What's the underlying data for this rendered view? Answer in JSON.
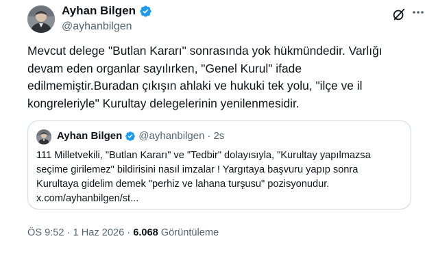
{
  "author": {
    "name": "Ayhan Bilgen",
    "handle": "@ayhanbilgen"
  },
  "icons": {
    "verified": "verified-badge-icon",
    "grok": "grok-icon",
    "more": "more-options-icon"
  },
  "colors": {
    "verified_blue": "#1d9bf0",
    "secondary_text": "#536471",
    "primary_text": "#0f1419",
    "border": "#cfd9de"
  },
  "tweet": {
    "lines": [
      "Mevcut delege \"Butlan Kararı\" sonrasında yok hükmündedir. Varlığı",
      "devam eden organlar sayılırken, \"Genel Kurul\" ifade",
      "edilmemiştir.Buradan çıkışın ahlaki ve hukuki tek yolu, \"ilçe ve il",
      "kongreleriyle\" Kurultay delegelerinin yenilenmesidir."
    ]
  },
  "quote": {
    "name": "Ayhan Bilgen",
    "handle": "@ayhanbilgen",
    "separator": "·",
    "time": "2s",
    "lines": [
      "111 Milletvekili, \"Butlan Kararı\" ve \"Tedbir\" dolayısıyla, \"Kurultay yapılmazsa",
      "seçime girilemez\" bildirisini nasıl imzalar ! Yargıtaya başvuru yapıp sonra",
      "Kurultaya gidelim demek \"perhiz ve lahana turşusu\" pozisyonudur.",
      "x.com/ayhanbilgen/st..."
    ]
  },
  "meta": {
    "time": "ÖS 9:52",
    "separator": "·",
    "date": "1 Haz 2026",
    "views_count": "6.068",
    "views_label": "Görüntüleme"
  }
}
